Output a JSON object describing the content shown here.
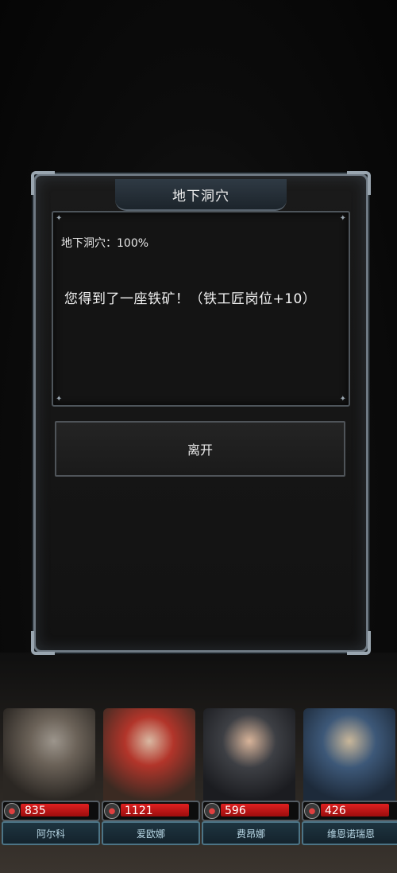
{
  "dialog": {
    "title": "地下洞穴",
    "progress_text": "地下洞穴：100%",
    "message": "您得到了一座铁矿！（铁工匠岗位+10）",
    "leave_label": "离开"
  },
  "party": [
    {
      "name": "阿尔科",
      "hp": "835",
      "colors": {
        "a": "#6b6258",
        "b": "#2b2723"
      }
    },
    {
      "name": "爱欧娜",
      "hp": "1121",
      "colors": {
        "a": "#b2352a",
        "b": "#3b2a22"
      }
    },
    {
      "name": "费昂娜",
      "hp": "596",
      "colors": {
        "a": "#3d3f44",
        "b": "#1b1c20"
      }
    },
    {
      "name": "维恩诺瑞恩",
      "hp": "426",
      "colors": {
        "a": "#3d5878",
        "b": "#1d2a3a"
      }
    }
  ],
  "colors": {
    "hp_bar": "#d41c1c",
    "frame": "#6f7a84",
    "name_border": "#4c7486"
  }
}
